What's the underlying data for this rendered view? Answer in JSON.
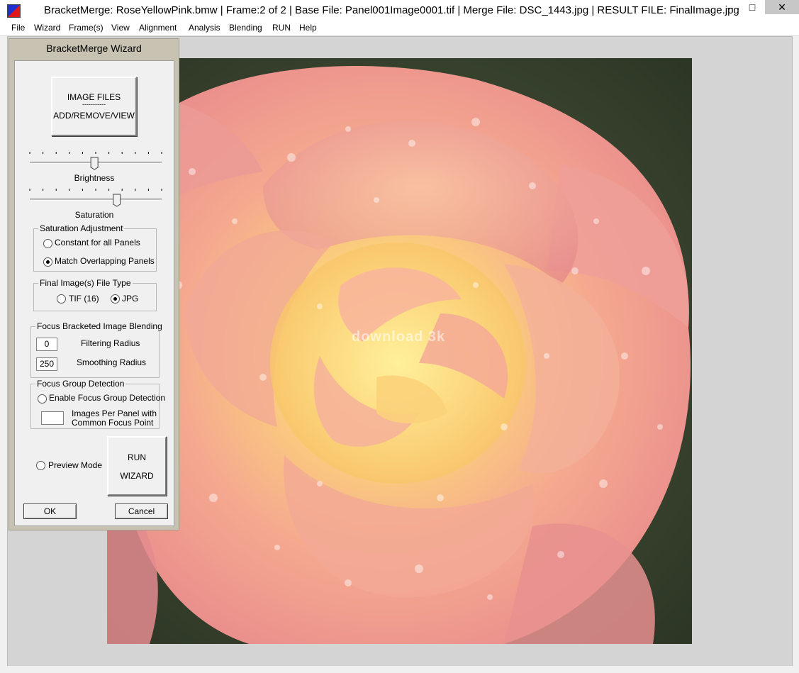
{
  "window": {
    "title": "BracketMerge: RoseYellowPink.bmw | Frame:2 of 2 | Base File: Panel001Image0001.tif | Merge File: DSC_1443.jpg | RESULT FILE: FinalImage.jpg",
    "minimize": "–",
    "maximize": "□",
    "close": "✕"
  },
  "menu": [
    "File",
    "Wizard",
    "Frame(s)",
    "View",
    "Alignment",
    "Analysis",
    "Blending",
    "RUN",
    "Help"
  ],
  "watermark": "download 3k",
  "wizard": {
    "title": "BracketMerge Wizard",
    "image_files_line1": "IMAGE FILES",
    "image_files_dots": "-----------",
    "image_files_line2": "ADD/REMOVE/VIEW",
    "brightness_label": "Brightness",
    "brightness_level": 0.49,
    "saturation_label": "Saturation",
    "saturation_level": 0.66,
    "sat_adjust": {
      "title": "Saturation Adjustment",
      "opt1": "Constant for all Panels",
      "opt2": "Match Overlapping Panels",
      "selected": "opt2"
    },
    "file_type": {
      "title": "Final Image(s) File Type",
      "opt1": "TIF (16)",
      "opt2": "JPG",
      "selected": "opt2"
    },
    "focus_blend": {
      "title": "Focus Bracketed Image Blending",
      "filtering_value": "0",
      "filtering_label": "Filtering Radius",
      "smoothing_value": "250",
      "smoothing_label": "Smoothing Radius"
    },
    "focus_group": {
      "title": "Focus Group Detection",
      "enable_label": "Enable Focus Group Detection",
      "images_line1": "Images Per Panel with",
      "images_line2": "Common Focus Point",
      "images_value": ""
    },
    "preview_label": "Preview Mode",
    "run_line1": "RUN",
    "run_line2": "WIZARD",
    "ok": "OK",
    "cancel": "Cancel"
  }
}
